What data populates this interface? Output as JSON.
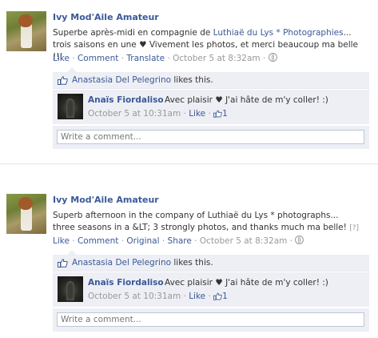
{
  "posts": [
    {
      "author": "Ivy Mod'Aile Amateur",
      "message_before_link": "Superbe après-midi en compagnie de ",
      "message_link": "Luthiaë du Lys * Photographies",
      "message_after_link": "... trois saisons en une ♥ Vivement les photos, et merci beaucoup ma belle !!!",
      "actions": {
        "like": "Like",
        "comment": "Comment",
        "translate": "Translate",
        "timestamp": "October 5 at 8:32am"
      },
      "likes": {
        "name": "Anastasia Del Pelegrino",
        "suffix": "likes this."
      },
      "comment": {
        "author": "Anaïs Fiordaliso",
        "text": "Avec plaisir ♥ J'ai hâte de m'y coller! :)",
        "timestamp": "October 5 at 10:31am",
        "like": "Like",
        "like_count": "1"
      },
      "write_placeholder": "Write a comment..."
    },
    {
      "author": "Ivy Mod'Aile Amateur",
      "message": "Superb afternoon in the company of Luthiaë du Lys * photographs... three seasons in a &LT; 3 strongly photos, and thanks much ma belle!",
      "question_mark": "[?]",
      "actions": {
        "like": "Like",
        "comment": "Comment",
        "original": "Original",
        "share": "Share",
        "timestamp": "October 5 at 8:32am"
      },
      "likes": {
        "name": "Anastasia Del Pelegrino",
        "suffix": "likes this."
      },
      "comment": {
        "author": "Anaïs Fiordaliso",
        "text": "Avec plaisir ♥ J'ai hâte de m'y coller! :)",
        "timestamp": "October 5 at 10:31am",
        "like": "Like",
        "like_count": "1"
      },
      "write_placeholder": "Write a comment..."
    }
  ],
  "colors": {
    "link": "#3b5998",
    "panel": "#edeff4",
    "meta": "#999999"
  }
}
